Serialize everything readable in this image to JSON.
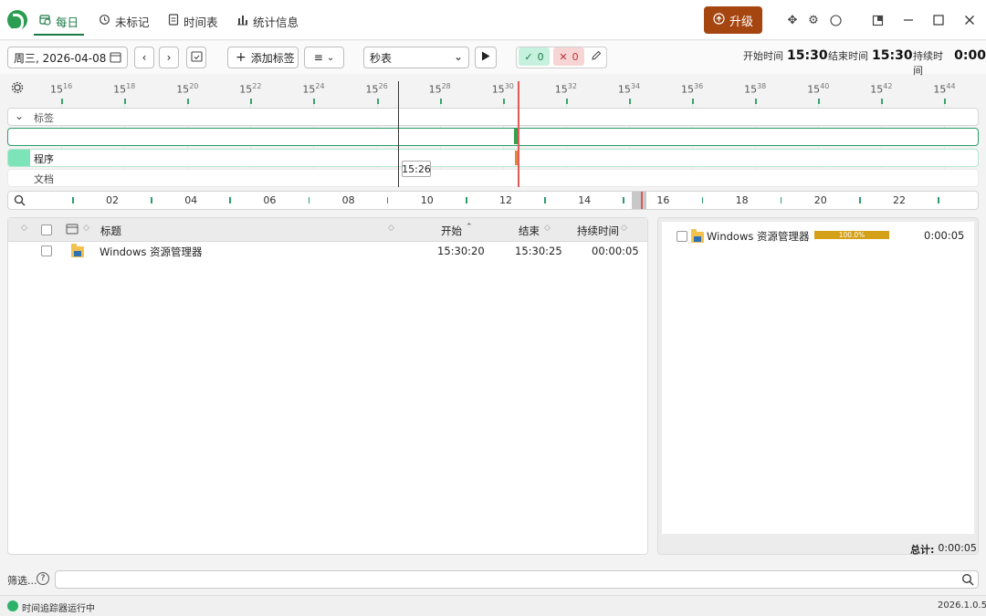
{
  "nav": {
    "tabs": [
      {
        "label": "每日",
        "icon": "calendar-clock-icon"
      },
      {
        "label": "未标记",
        "icon": "refresh-clock-icon"
      },
      {
        "label": "时间表",
        "icon": "document-icon"
      },
      {
        "label": "统计信息",
        "icon": "bar-chart-icon"
      }
    ],
    "upgrade_label": "升级"
  },
  "toolbar": {
    "date": "周三, 2026-04-08",
    "add_tag_label": "添加标签",
    "mode_select": "秒表",
    "check_count": "0",
    "cross_count": "0",
    "start_label": "开始时间",
    "start_value": "15:30",
    "end_label": "结束时间",
    "end_value": "15:30",
    "duration_label": "持续时间",
    "duration_value": "0:00"
  },
  "timeline": {
    "ticks": [
      {
        "h": "15",
        "m": "16"
      },
      {
        "h": "15",
        "m": "18"
      },
      {
        "h": "15",
        "m": "20"
      },
      {
        "h": "15",
        "m": "22"
      },
      {
        "h": "15",
        "m": "24"
      },
      {
        "h": "15",
        "m": "26"
      },
      {
        "h": "15",
        "m": "28"
      },
      {
        "h": "15",
        "m": "30"
      },
      {
        "h": "15",
        "m": "32"
      },
      {
        "h": "15",
        "m": "34"
      },
      {
        "h": "15",
        "m": "36"
      },
      {
        "h": "15",
        "m": "38"
      },
      {
        "h": "15",
        "m": "40"
      },
      {
        "h": "15",
        "m": "42"
      },
      {
        "h": "15",
        "m": "44"
      }
    ],
    "rows": {
      "tags": "标签",
      "programs": "程序",
      "documents": "文档"
    },
    "cursor_tooltip": "15:26",
    "hours": [
      "02",
      "04",
      "06",
      "08",
      "10",
      "12",
      "14",
      "16",
      "18",
      "20",
      "22"
    ]
  },
  "table": {
    "headers": {
      "title": "标题",
      "start": "开始",
      "end": "结束",
      "duration": "持续时间"
    },
    "rows": [
      {
        "title": "Windows 资源管理器",
        "start": "15:30:20",
        "end": "15:30:25",
        "duration": "00:00:05"
      }
    ]
  },
  "summary": {
    "items": [
      {
        "name": "Windows 资源管理器",
        "percent_label": "100.0%",
        "percent": 100,
        "duration": "0:00:05"
      }
    ],
    "total_label": "总计:",
    "total_value": "0:00:05"
  },
  "filter": {
    "label": "筛选..."
  },
  "status": {
    "text": "时间追踪器运行中",
    "version": "2026.1.0.5"
  },
  "colors": {
    "accent": "#1b7a45",
    "upgrade": "#a5450f",
    "bar": "#d4a017",
    "program_row": "#7de3b8"
  }
}
